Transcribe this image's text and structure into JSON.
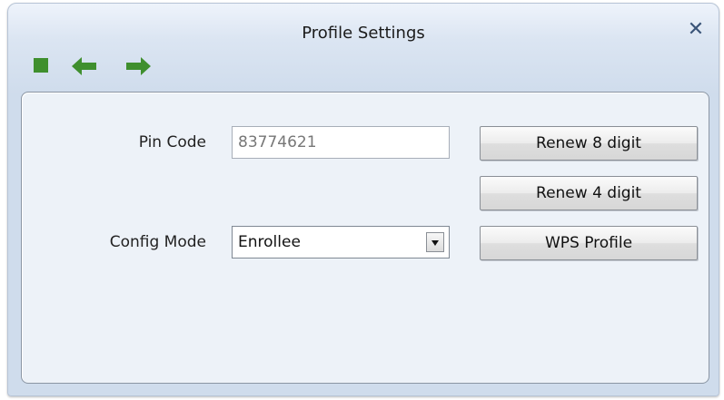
{
  "window": {
    "title": "Profile Settings",
    "close_symbol": "✕"
  },
  "toolbar": {
    "icons": [
      "stop-icon",
      "back-arrow-icon",
      "forward-arrow-icon"
    ],
    "icon_color": "#3f8f2e"
  },
  "form": {
    "pin_code_label": "Pin Code",
    "pin_code_value": "83774621",
    "config_mode_label": "Config Mode",
    "config_mode_value": "Enrollee"
  },
  "buttons": {
    "renew8": "Renew 8 digit",
    "renew4": "Renew 4 digit",
    "wps_profile": "WPS Profile"
  }
}
